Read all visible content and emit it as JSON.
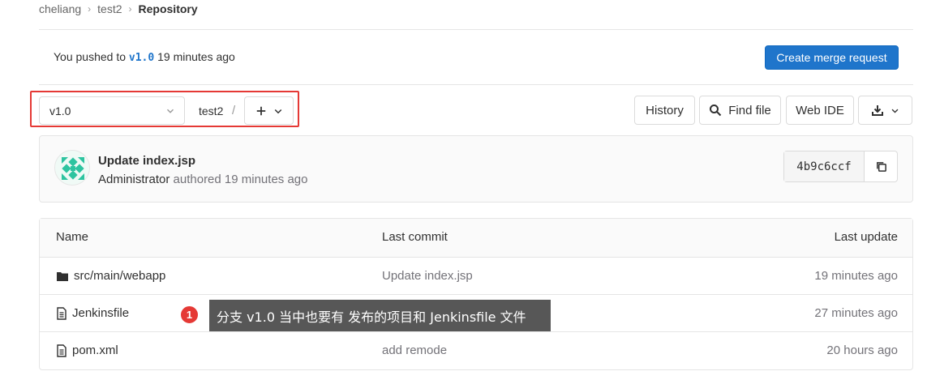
{
  "breadcrumb": {
    "items": [
      "cheliang",
      "test2"
    ],
    "current": "Repository"
  },
  "push_notice": {
    "prefix": "You pushed to ",
    "branch": "v1.0",
    "suffix": " 19 minutes ago",
    "button": "Create merge request"
  },
  "tree_nav": {
    "branch": "v1.0",
    "path_root": "test2",
    "separator": "/"
  },
  "toolbar": {
    "history": "History",
    "find_file": "Find file",
    "web_ide": "Web IDE"
  },
  "last_commit": {
    "title": "Update index.jsp",
    "author": "Administrator",
    "meta": " authored 19 minutes ago",
    "sha": "4b9c6ccf"
  },
  "table": {
    "headers": {
      "name": "Name",
      "last_commit": "Last commit",
      "last_update": "Last update"
    },
    "rows": [
      {
        "name": "src/main/webapp",
        "type": "folder",
        "commit": "Update index.jsp",
        "updated": "19 minutes ago"
      },
      {
        "name": "Jenkinsfile",
        "type": "file",
        "commit": "",
        "updated": "27 minutes ago"
      },
      {
        "name": "pom.xml",
        "type": "file",
        "commit": "add remode",
        "updated": "20 hours ago"
      }
    ]
  },
  "annotation": {
    "number": "1",
    "text": "分支 v1.0 当中也要有 发布的项目和 Jenkinsfile 文件"
  },
  "colors": {
    "primary": "#1f75cb",
    "annotation_red": "#e53935",
    "tooltip_bg": "#575757"
  }
}
